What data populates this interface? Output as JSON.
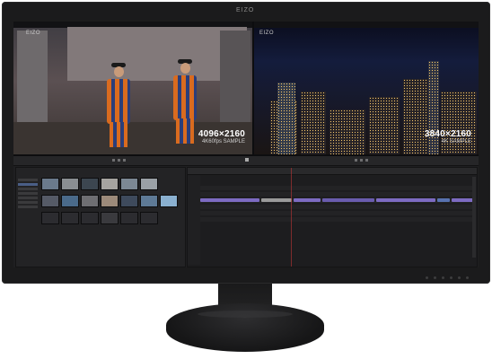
{
  "monitor": {
    "brand": "EIZO"
  },
  "previews": {
    "left": {
      "logo": "EIZO",
      "resolution": "4096×2160",
      "caption": "4K60fps SAMPLE"
    },
    "right": {
      "logo": "EIZO",
      "resolution": "3840×2160",
      "caption": "4K SAMPLE"
    }
  },
  "colors": {
    "bezel": "#1b1b1c",
    "clip_purple": "#7d6bc2",
    "clip_blue": "#5872b0",
    "clip_gray": "#9a9a9a",
    "playhead": "#c03636"
  }
}
